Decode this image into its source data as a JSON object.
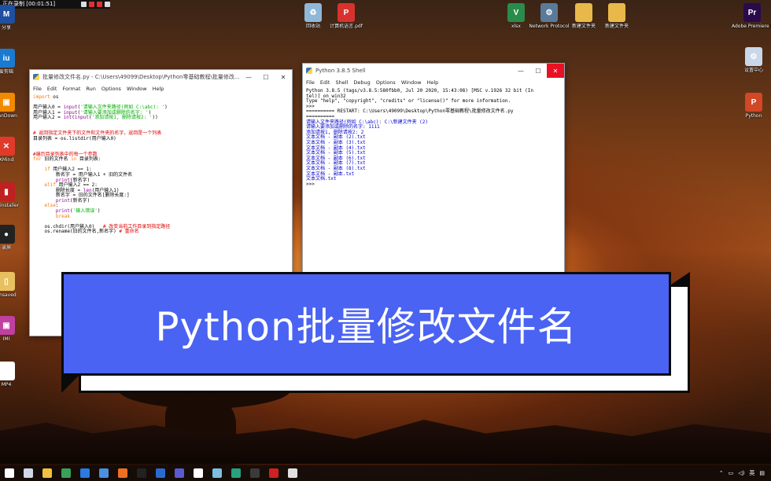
{
  "recording": {
    "text": "正在录制 [00:01:51]"
  },
  "desktop_icons_top": [
    {
      "name": "recycle-bin-icon",
      "label": "回收站",
      "color": "#8fb8d8"
    },
    {
      "name": "pdf-file-icon",
      "label": "计算机语言.pdf",
      "color": "#d9322e"
    },
    {
      "name": "wps-icon",
      "label": "xlsx",
      "color": "#2a8c4a"
    },
    {
      "name": "network-icon",
      "label": "Network Protocol",
      "color": "#5a7a9a"
    },
    {
      "name": "folder-icon",
      "label": "新建文件夹",
      "color": "#e8b84a"
    },
    {
      "name": "folder-icon-2",
      "label": "新建文件夹",
      "color": "#e8b84a"
    },
    {
      "name": "premiere-icon",
      "label": "Adobe Premiere Pro",
      "color": "#2a0a4a"
    }
  ],
  "desktop_icons_left": [
    {
      "name": "app-icon-m",
      "label": "分享",
      "color": "#1e4fa0"
    },
    {
      "name": "app-icon-blue",
      "label": "爱剪辑",
      "color": "#1a7ad0"
    },
    {
      "name": "app-icon-orange",
      "label": "PanDown",
      "color": "#f08a00"
    },
    {
      "name": "xmind-icon",
      "label": "XMind",
      "color": "#e03a2a"
    },
    {
      "name": "app-icon-red",
      "label": "Uninstaller",
      "color": "#c02020"
    },
    {
      "name": "app-icon-rec",
      "label": "录屏",
      "color": "#222"
    },
    {
      "name": "app-icon-doc",
      "label": "unsaved",
      "color": "#e8c060"
    },
    {
      "name": "app-icon-pink",
      "label": "IMI",
      "color": "#c040a0"
    },
    {
      "name": "app-icon-mp4",
      "label": "MP4",
      "color": "#fff"
    }
  ],
  "desktop_icons_right": [
    {
      "name": "app-icon-settings",
      "label": "设置中心",
      "color": "#c8d8e8"
    },
    {
      "name": "ppt-icon",
      "label": "Python",
      "color": "#d24726"
    }
  ],
  "editor": {
    "title": "批量修改文件名.py - C:\\Users\\49099\\Desktop\\Python零基础教程\\批量修改...",
    "menu": [
      "File",
      "Edit",
      "Format",
      "Run",
      "Options",
      "Window",
      "Help"
    ],
    "lines": [
      "import os",
      "",
      "用户输入0 = input('请输入文件夹路径(例如 C:\\abc): ')",
      "用户输入1 = input('请输入要添加或删除的名字: ')",
      "用户输入2 = int(input('添加请按1, 删除请按2: '))",
      "",
      "",
      "# 返回指定文件夹下的文件和文件夹的名字，返回是一个列表",
      "目录列表 = os.listdir(用户输入0)",
      "",
      "",
      "#遍历目录列表中的每一个参数",
      "for 旧的文件名 in 目录列表:",
      "",
      "    if 用户输入2 == 1:",
      "        新名字 = 用户输入1 + 旧的文件名",
      "        print(新名字)",
      "    elif 用户输入2 == 2:",
      "        删除长度 = len(用户输入1)",
      "        新名字 = 旧的文件名[删除长度:]",
      "        print(新名字)",
      "    else:",
      "        print('输入错误')",
      "        break",
      "",
      "    os.chdir(用户输入0)   # 改变当前工作目录到指定路径",
      "    os.rename(旧的文件名,新名字) # 重命名"
    ]
  },
  "shell": {
    "title": "Python 3.8.5 Shell",
    "menu": [
      "File",
      "Edit",
      "Shell",
      "Debug",
      "Options",
      "Window",
      "Help"
    ],
    "lines": [
      "Python 3.8.5 (tags/v3.8.5:580fbb0, Jul 20 2020, 15:43:08) [MSC v.1926 32 bit (In",
      "tel)] on win32",
      "Type \"help\", \"copyright\", \"credits\" or \"license()\" for more information.",
      ">>> ",
      "========== RESTART: C:\\Users\\49099\\Desktop\\Python零基础教程\\批量修改文件名.py",
      "==========",
      "请输入文件夹路径(例如 C:\\abc): C:\\新建文件夹 (2)",
      "请输入要添加或删除的名字: 1111",
      "添加请按1, 删除请按2: 2",
      "文本文档 - 副本 (2).txt",
      "文本文档 - 副本 (3).txt",
      "文本文档 - 副本 (4).txt",
      "文本文档 - 副本 (5).txt",
      "文本文档 - 副本 (6).txt",
      "文本文档 - 副本 (7).txt",
      "文本文档 - 副本 (8).txt",
      "文本文档 - 副本.txt",
      "文本文档.txt",
      ">>> "
    ]
  },
  "banner": {
    "text": "Python批量修改文件名"
  },
  "taskbar": {
    "icons": [
      {
        "name": "start-icon",
        "color": "#ffffff"
      },
      {
        "name": "task-view-icon",
        "color": "#cfd8e8"
      },
      {
        "name": "file-explorer-icon",
        "color": "#f0c040"
      },
      {
        "name": "app-icon-tb1",
        "color": "#3aa05a"
      },
      {
        "name": "browser-icon",
        "color": "#2a7ae0"
      },
      {
        "name": "app-icon-tb2",
        "color": "#4a90e0"
      },
      {
        "name": "app-icon-tb3",
        "color": "#f07020"
      },
      {
        "name": "qq-icon",
        "color": "#222"
      },
      {
        "name": "app-icon-tb4",
        "color": "#2a6ad0"
      },
      {
        "name": "app-icon-tb5",
        "color": "#5a5ad0"
      },
      {
        "name": "app-icon-tb6",
        "color": "#ffffff"
      },
      {
        "name": "app-icon-tb7",
        "color": "#7ac0e0"
      },
      {
        "name": "app-icon-tb8",
        "color": "#2aa080"
      },
      {
        "name": "app-icon-tb9",
        "color": "#3a3a3a"
      },
      {
        "name": "record-icon",
        "color": "#d02020"
      },
      {
        "name": "app-icon-tb10",
        "color": "#e0e0e0"
      }
    ],
    "ime": "英",
    "time": ""
  }
}
